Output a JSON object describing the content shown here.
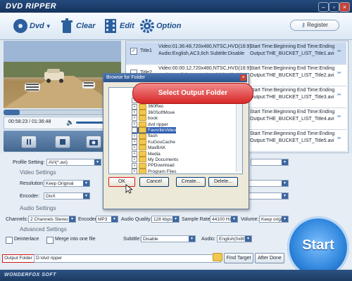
{
  "app": {
    "brand": "DVD RIPPER",
    "footer_brand": "WONDERFOX SOFT"
  },
  "toolbar": {
    "dvd_label": "Dvd",
    "clear_label": "Clear",
    "edit_label": "Edit",
    "option_label": "Option",
    "register_label": "Register"
  },
  "player": {
    "time": "00:58:23 / 01:36:48",
    "seek_progress": 0.14,
    "volume_progress": 0.85
  },
  "titles": [
    {
      "name": "Title1",
      "checked": true,
      "info_line1": "Video:01:36:48,720x480,NTSC,HVD(16:9)",
      "info_line2": "Audio:English,AC3,6ch Subtitle:Disable",
      "time_line": "Start Time:Beginning End Time:Ending",
      "output_line": "Output:THE_BUCKET_LIST_Title1.avi"
    },
    {
      "name": "Title2",
      "checked": false,
      "info_line1": "Video:00:00:12,720x480,NTSC,HVD(16:9)",
      "info_line2": "Audio:English,AC3,6ch Subtitle:Disable",
      "time_line": "Start Time:Beginning End Time:Ending",
      "output_line": "Output:THE_BUCKET_LIST_Title2.avi"
    },
    {
      "name": "Title3",
      "checked": false,
      "time_line": "Start Time:Beginning End Time:Ending",
      "output_line": "Output:THE_BUCKET_LIST_Title3.avi"
    },
    {
      "name": "Title4",
      "checked": false,
      "time_line": "Start Time:Beginning End Time:Ending",
      "output_line": "Output:THE_BUCKET_LIST_Title4.avi"
    },
    {
      "name": "Title5",
      "checked": false,
      "time_line": "Start Time:Beginning End Time:Ending",
      "output_line": "Output:THE_BUCKET_LIST_Title5.avi"
    }
  ],
  "settings": {
    "profile_label": "Profile Setting:",
    "profile_value": "AVI(*.avi)",
    "video_section": "Video Settings",
    "resolution_label": "Resolution:",
    "resolution_value": "Keep Original",
    "encoder_label": "Encoder:",
    "encoder_value": "DivX",
    "audio_section": "Audio Settings",
    "channels_label": "Channels:",
    "channels_value": "2 Channels Stereo",
    "audio_encoder_label": "Encoder:",
    "audio_encoder_value": "MP3",
    "audio_quality_label": "Audio Quality:",
    "audio_quality_value": "128 kbps",
    "sample_rate_label": "Sample Rate:",
    "sample_rate_value": "44100 Hz",
    "volume_label": "Volume:",
    "volume_value": "Keep origina",
    "advanced_section": "Advanced Settings",
    "deinterlace_label": "Deinterlace",
    "merge_label": "Merge into one file",
    "subtitle_label": "Subtitle:",
    "subtitle_value": "Disable",
    "audio_label": "Audio:",
    "audio_value": "English(0x80)"
  },
  "output": {
    "label": "Output Folder",
    "path": "D:\\dvd ripper",
    "find_target": "Find Target",
    "after_done": "After Done"
  },
  "start_label": "Start",
  "dialog": {
    "title": "Browse for Folder",
    "callout": "Select Output Folder",
    "folders": [
      "360Downloads",
      "360Rec",
      "360SoftMove",
      "book",
      "dvd ripper",
      "FavoriteVideo",
      "flash",
      "KuGouCache",
      "MaxBAK",
      "Media",
      "My Documents",
      "PPDownload",
      "Program Files"
    ],
    "selected_folder": "FavoriteVideo",
    "ok": "OK",
    "cancel": "Cancel",
    "create": "Create...",
    "delete": "Delete..."
  },
  "colors": {
    "accent": "#2a538e",
    "start_button": "#2f86dc",
    "callout": "#d72727",
    "highlight": "#d31818"
  }
}
